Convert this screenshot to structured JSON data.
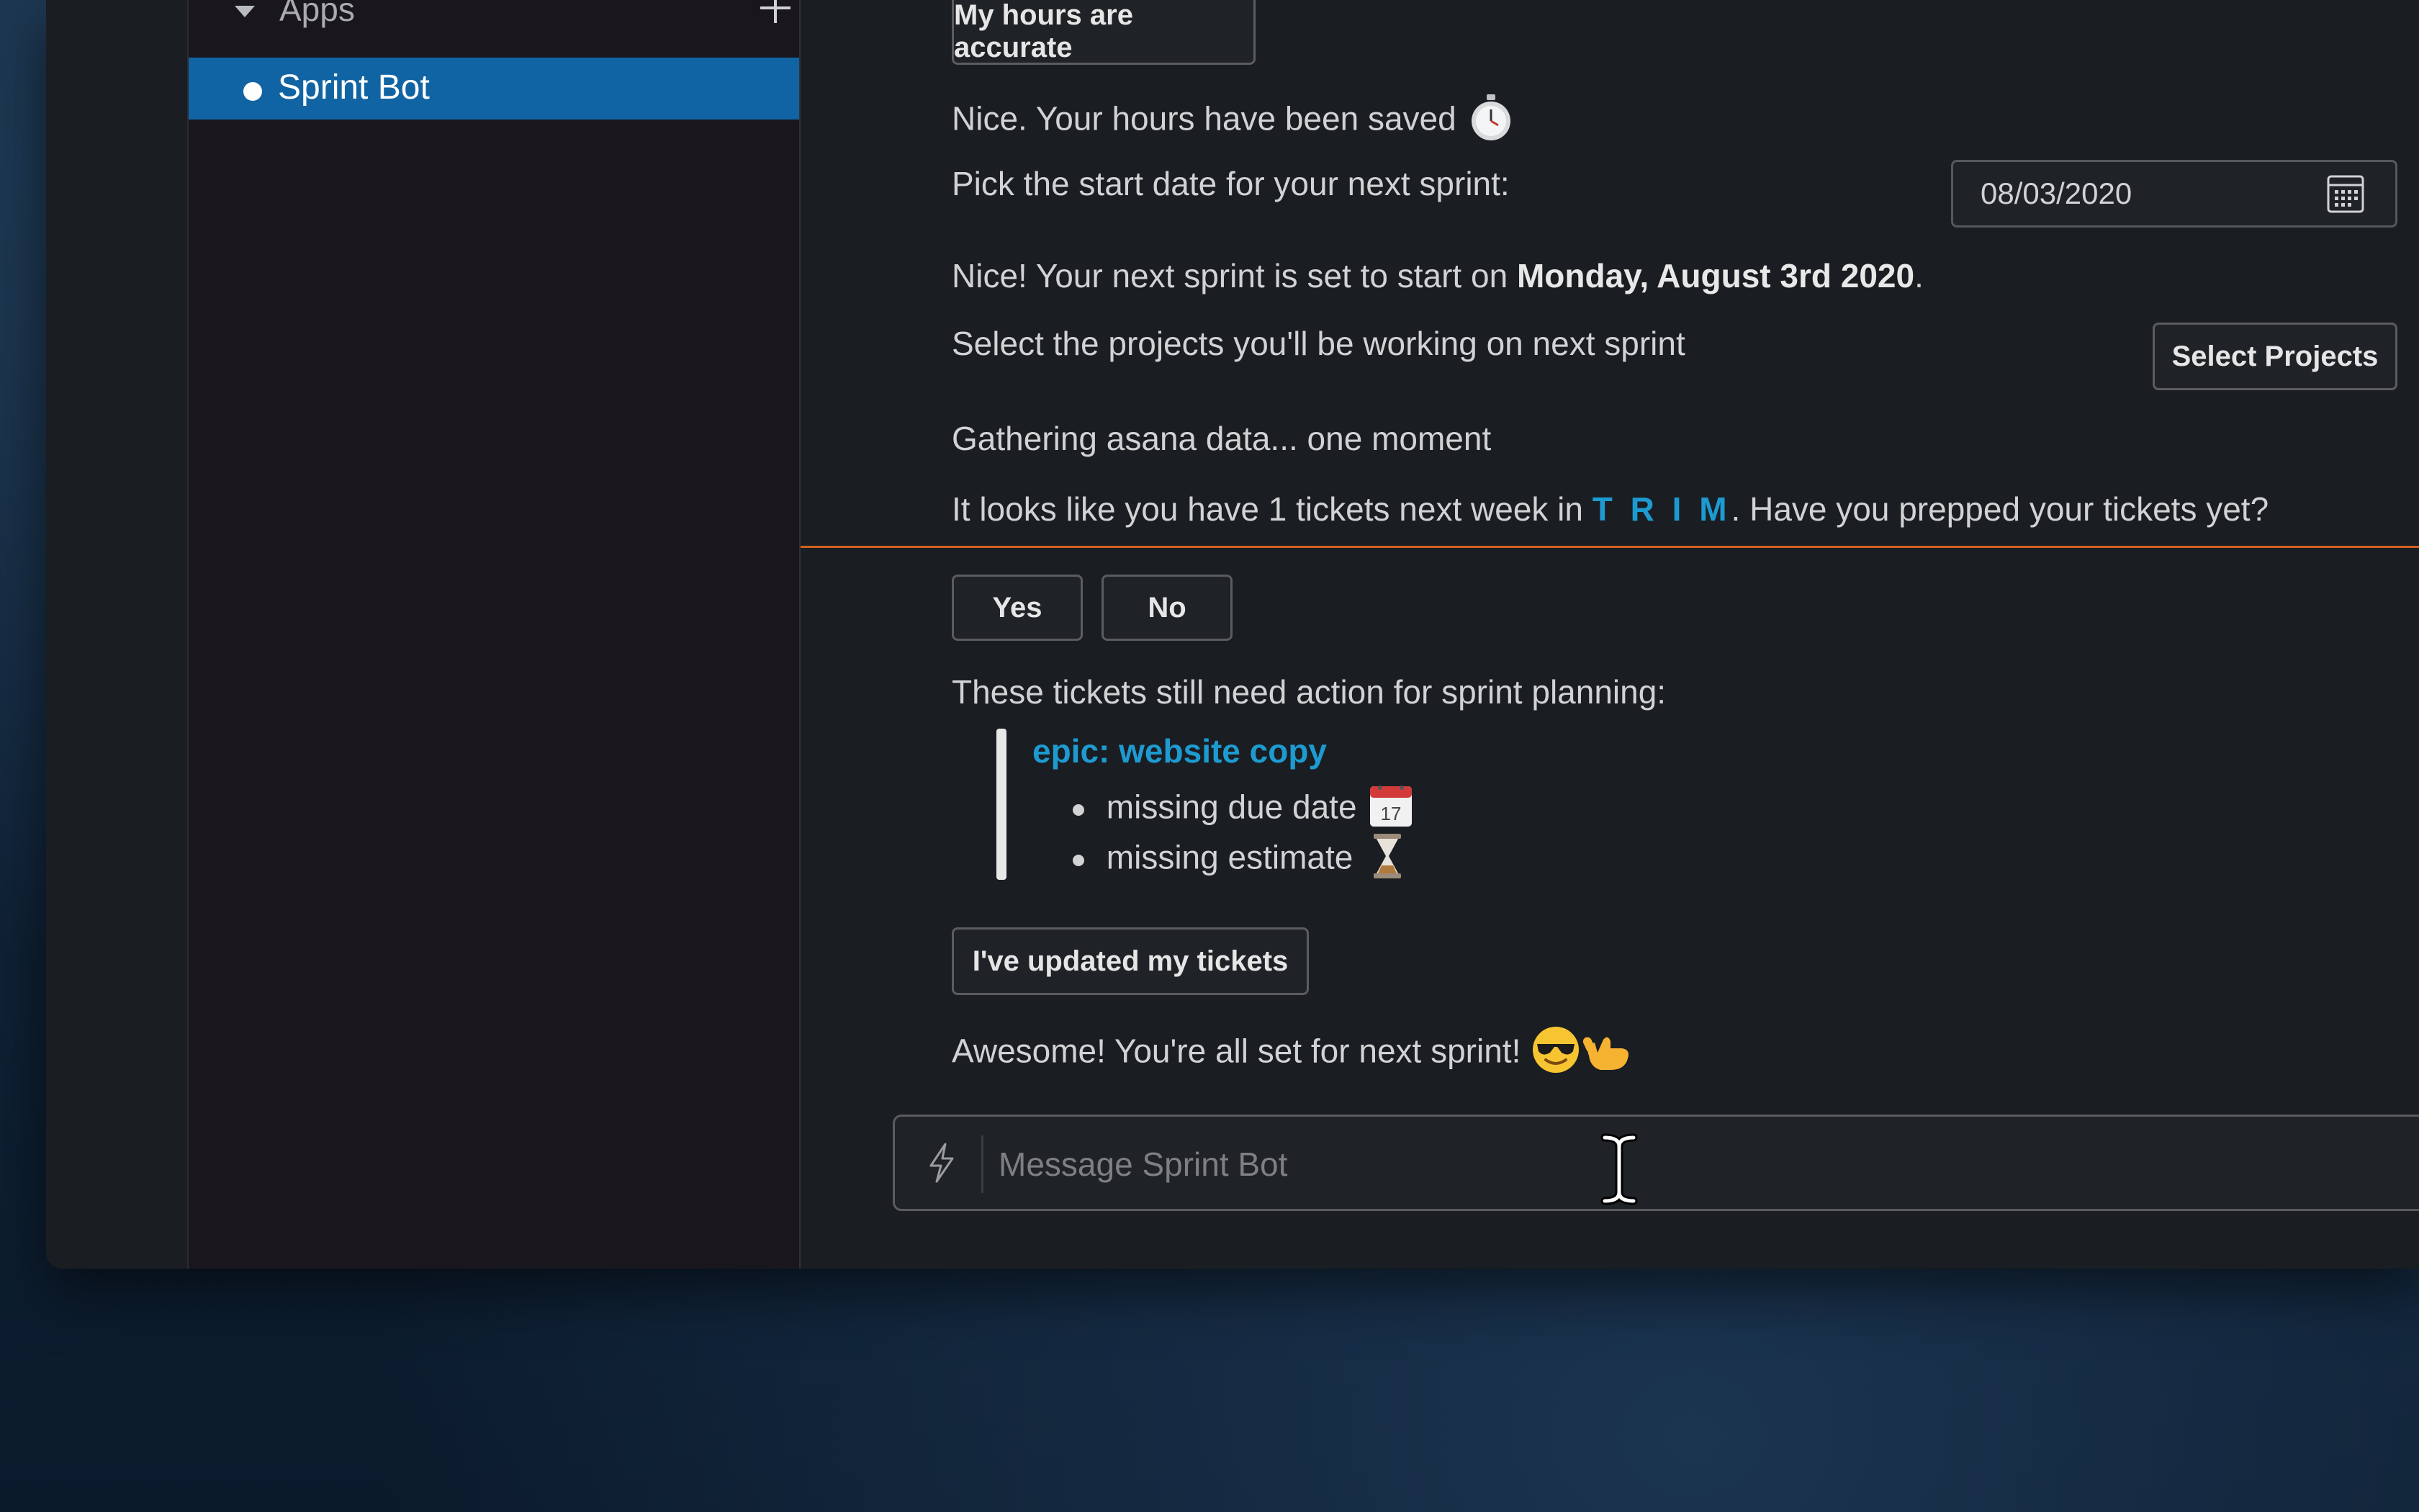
{
  "sidebar": {
    "section_label": "Apps",
    "items": [
      {
        "label": "Sprint Bot"
      }
    ]
  },
  "messages": {
    "hours_button": "My hours are accurate",
    "hours_saved": "Nice. Your hours have been saved",
    "pick_date": "Pick the start date for your next sprint:",
    "date_value": "08/03/2020",
    "sprint_set_prefix": "Nice! Your next sprint is set to start on ",
    "sprint_set_date": "Monday, August 3rd 2020",
    "sprint_set_suffix": ".",
    "select_projects_text": "Select the projects you'll be working on next sprint",
    "select_projects_button": "Select Projects",
    "gathering": "Gathering asana data... one moment",
    "tickets_prefix": "It looks like you have 1 tickets next week in ",
    "tickets_project": "T R I M",
    "tickets_suffix": ". Have you prepped your tickets yet?",
    "yes_button": "Yes",
    "no_button": "No",
    "needs_action": "These tickets still need action for sprint planning:",
    "epic_link": "epic: website copy",
    "missing_due_date": "missing due date",
    "missing_estimate": "missing estimate",
    "updated_button": "I've updated my tickets",
    "all_set": "Awesome! You're all set for next sprint!"
  },
  "composer": {
    "placeholder": "Message Sprint Bot"
  },
  "colors": {
    "accent_selected": "#1164a3",
    "link": "#1d9bd1",
    "new_divider": "#d0601f"
  },
  "icons": [
    "chevron-down-icon",
    "plus-icon",
    "stopwatch-icon",
    "calendar-icon",
    "calendar-emoji-icon",
    "hourglass-icon",
    "sunglasses-emoji-icon",
    "call-me-hand-emoji-icon",
    "lightning-icon",
    "text-cursor-icon"
  ]
}
